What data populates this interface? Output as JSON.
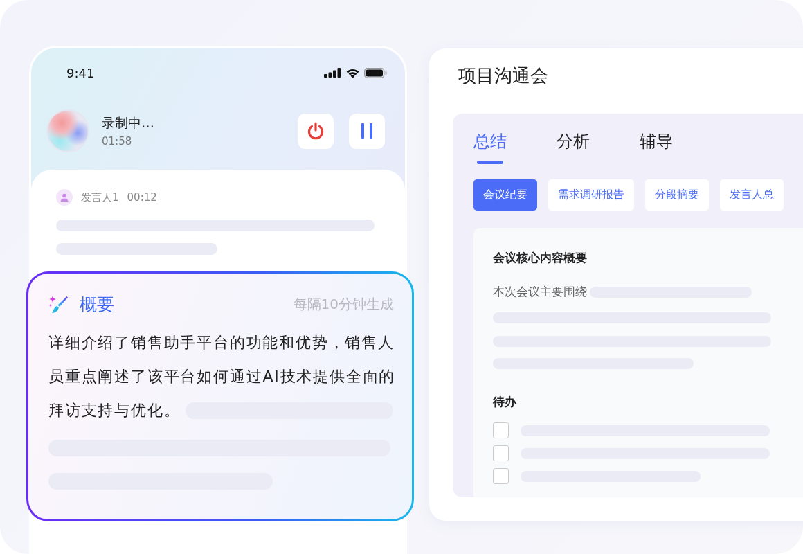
{
  "phone": {
    "status_bar": {
      "time": "9:41"
    },
    "recording": {
      "status": "录制中…",
      "elapsed": "01:58"
    },
    "transcript": {
      "speaker": "发言人1",
      "timestamp": "00:12"
    },
    "summary_card": {
      "title": "概要",
      "note": "每隔10分钟生成",
      "text_lines": [
        "详细介绍了销售助手平台的功能和优势，销售人",
        "员重点阐述了该平台如何通过AI技术提供全面的",
        "拜访支持与优化。"
      ]
    }
  },
  "meeting_panel": {
    "title": "项目沟通会",
    "tabs": [
      {
        "label": "总结",
        "selected": true
      },
      {
        "label": "分析",
        "selected": false
      },
      {
        "label": "辅导",
        "selected": false
      }
    ],
    "chips": [
      {
        "label": "会议纪要",
        "selected": true
      },
      {
        "label": "需求调研报告",
        "selected": false
      },
      {
        "label": "分段摘要",
        "selected": false
      },
      {
        "label": "发言人总",
        "selected": false
      }
    ],
    "summary": {
      "heading": "会议核心内容概要",
      "lead": "本次会议主要围绕"
    },
    "todo": {
      "heading": "待办",
      "items": [
        {
          "checked": false
        },
        {
          "checked": false
        },
        {
          "checked": false
        }
      ]
    }
  }
}
